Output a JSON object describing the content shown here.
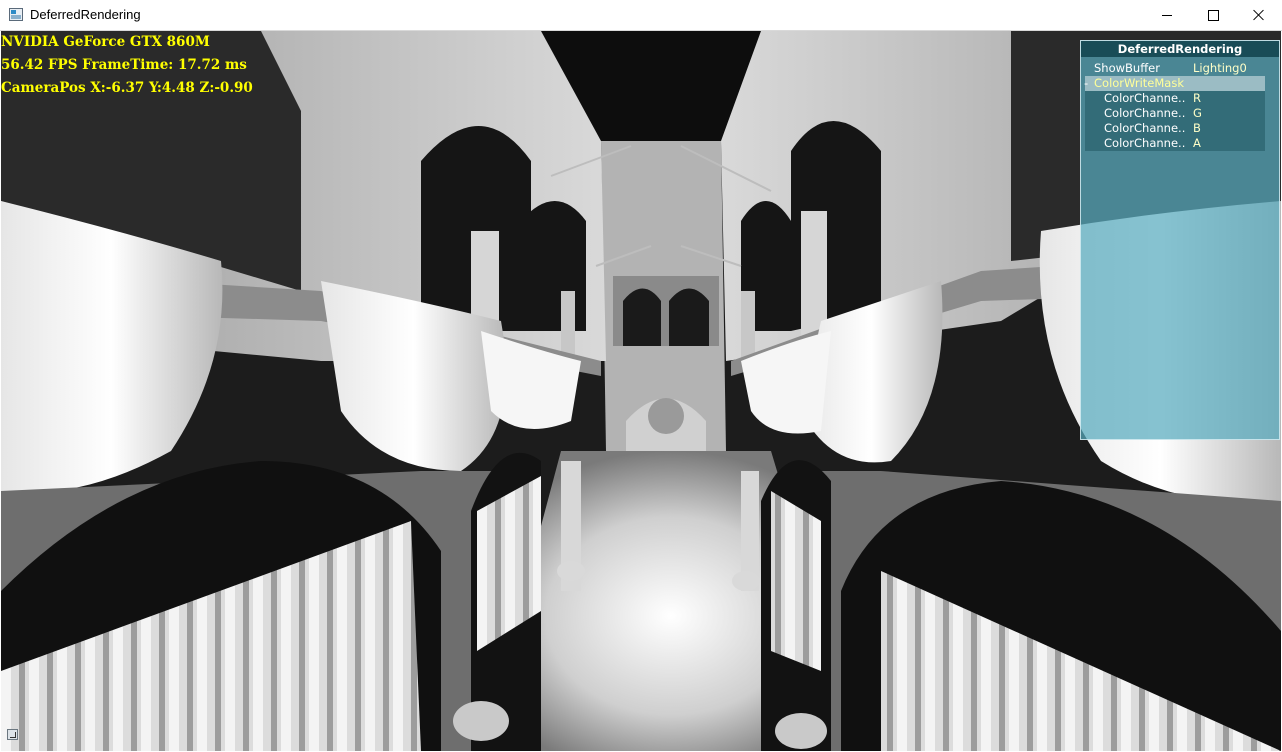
{
  "window": {
    "title": "DeferredRendering",
    "icon": "app-window-icon",
    "controls": [
      "minimize-icon",
      "maximize-icon",
      "close-icon"
    ]
  },
  "overlay": {
    "gpu": "NVIDIA GeForce GTX 860M",
    "perf": "56.42 FPS  FrameTime: 17.72 ms",
    "camera": "CameraPos X:-6.37 Y:4.48 Z:-0.90",
    "color": "#ffff00"
  },
  "tweakbar": {
    "title": "DeferredRendering",
    "show_buffer": {
      "label": "ShowBuffer",
      "value": "Lighting0"
    },
    "group": {
      "label": "ColorWriteMask",
      "expanded": true
    },
    "channels": [
      {
        "label": "ColorChanne..",
        "value": "R"
      },
      {
        "label": "ColorChanne..",
        "value": "G"
      },
      {
        "label": "ColorChanne..",
        "value": "B"
      },
      {
        "label": "ColorChanne..",
        "value": "A"
      }
    ]
  }
}
